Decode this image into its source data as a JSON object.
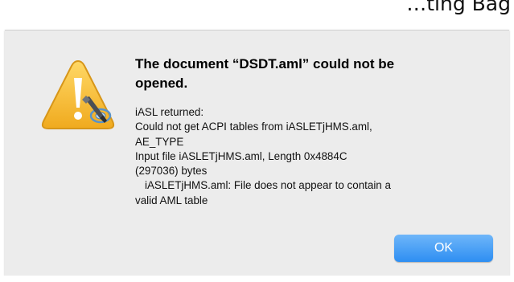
{
  "background_text": "…ting Bag",
  "dialog": {
    "icon": "warning-triangle-icon",
    "badge_icon": "wrench-gear-icon",
    "title_line_1": "The document “DSDT.aml” could not be",
    "title_line_2": "opened.",
    "message_lines": [
      "iASL returned:",
      "Could not get ACPI tables from iASLETjHMS.aml,",
      "AE_TYPE",
      "Input file iASLETjHMS.aml, Length 0x4884C",
      "(297036) bytes",
      "iASLETjHMS.aml: File does not appear to contain a",
      "valid AML table"
    ],
    "ok_label": "OK"
  },
  "colors": {
    "dialog_background": "#ececec",
    "button_blue": "#2d8ef2",
    "warning_yellow": "#f6c135"
  }
}
